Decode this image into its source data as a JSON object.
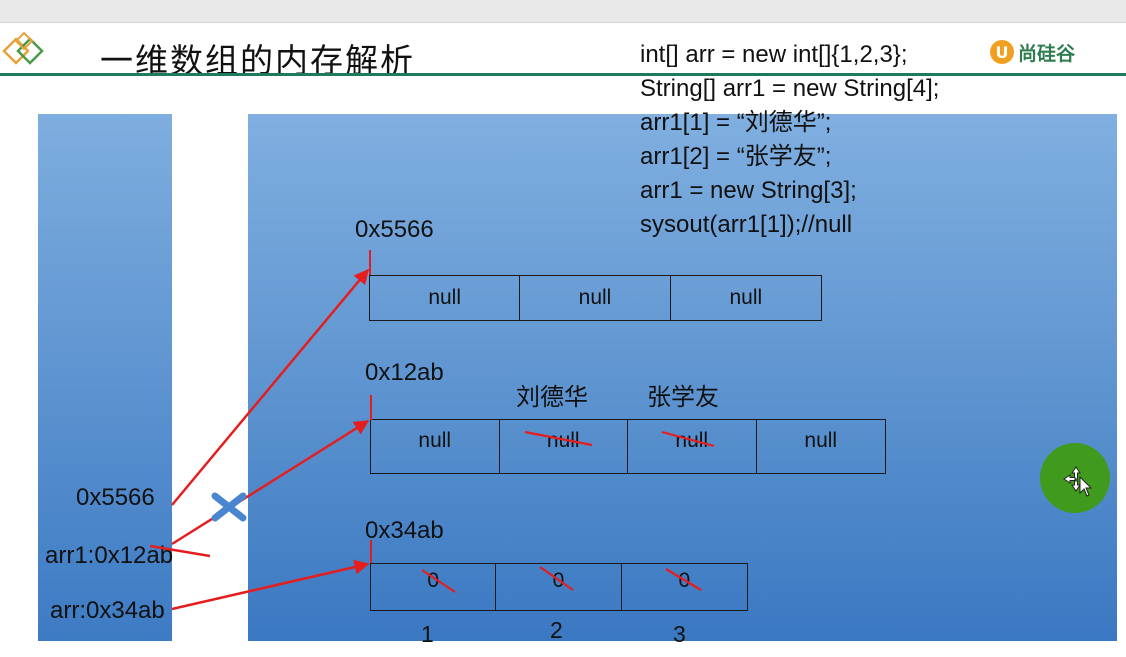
{
  "header": {
    "title": "一维数组的内存解析",
    "brand": "尚硅谷",
    "brand_mark": "U"
  },
  "code_lines": [
    "int[] arr = new int[]{1,2,3};",
    "String[] arr1 = new String[4];",
    "arr1[1] = “刘德华”;",
    "arr1[2] = “张学友”;",
    "arr1 = new String[3];",
    "sysout(arr1[1]);//null"
  ],
  "stack": {
    "var_new_arr1": "0x5566",
    "var_arr1": "arr1:0x12ab",
    "var_arr": "arr:0x34ab"
  },
  "heap": {
    "array_new": {
      "address": "0x5566",
      "cells": [
        "null",
        "null",
        "null"
      ]
    },
    "array_arr1": {
      "address": "0x12ab",
      "cells": [
        "null",
        "null",
        "null",
        "null"
      ],
      "labels": [
        "刘德华",
        "张学友"
      ]
    },
    "array_arr": {
      "address": "0x34ab",
      "cells": [
        "0",
        "0",
        "0"
      ],
      "indices": [
        "1",
        "2",
        "3"
      ]
    }
  },
  "colors": {
    "panel": "#5a91cf",
    "pointer": "#e41e1e",
    "accent_line": "#1f7a5c",
    "cursor": "#3f9a1e"
  },
  "icons": [
    "diamond-logo-icon",
    "cross-mark-icon",
    "move-cursor-icon"
  ]
}
